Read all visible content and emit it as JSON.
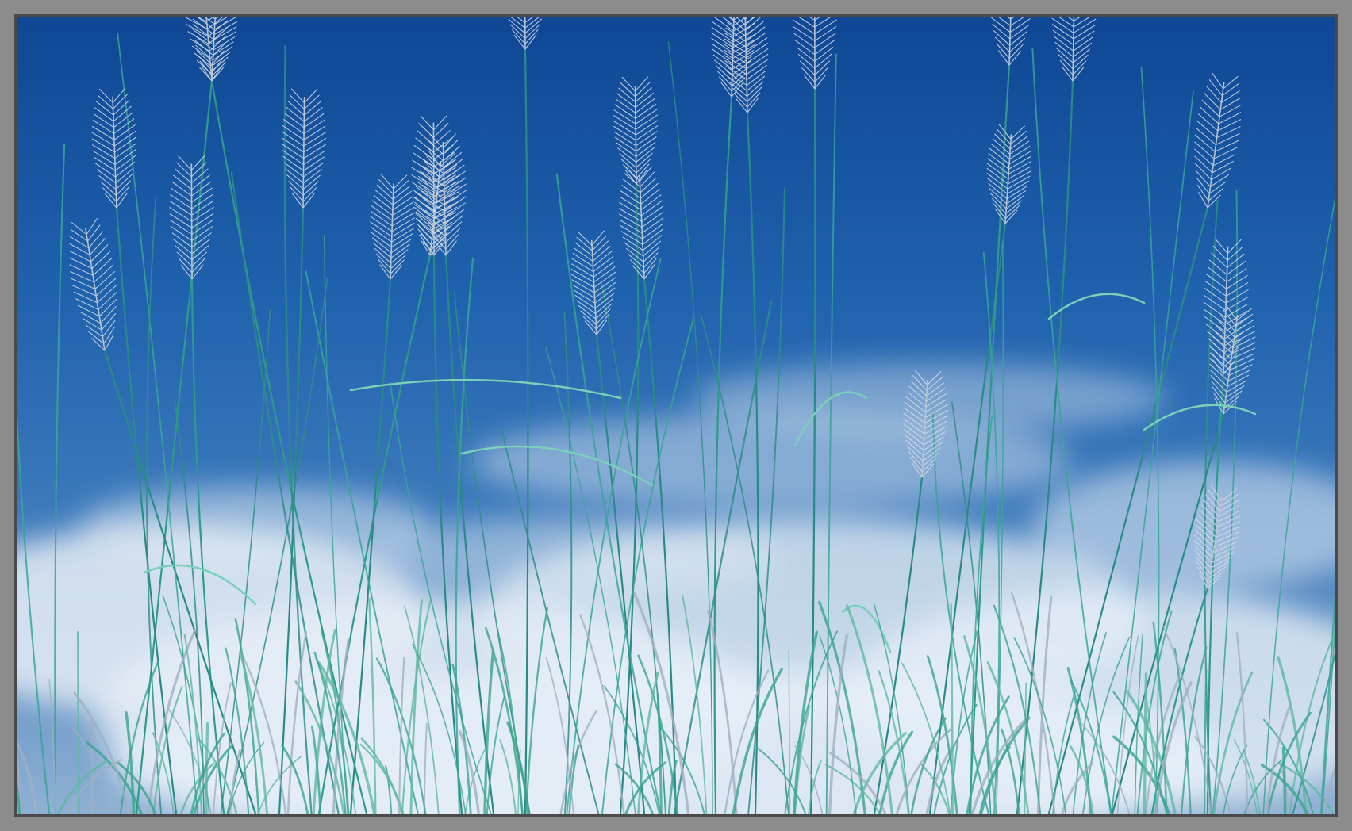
{
  "artwork": {
    "subject": "painting",
    "colors": {
      "sky_top": "#114a96",
      "sky_mid": "#2a6fb6",
      "sky_bottom": "#7fa4cc",
      "cloud": "#e8eef6",
      "stem": "#2f9a8c",
      "stem_light": "#7ad0b8",
      "seedhead": "#d8dde6",
      "frame": "#8c8c8c",
      "frame_border": "#4a4a4c"
    }
  }
}
